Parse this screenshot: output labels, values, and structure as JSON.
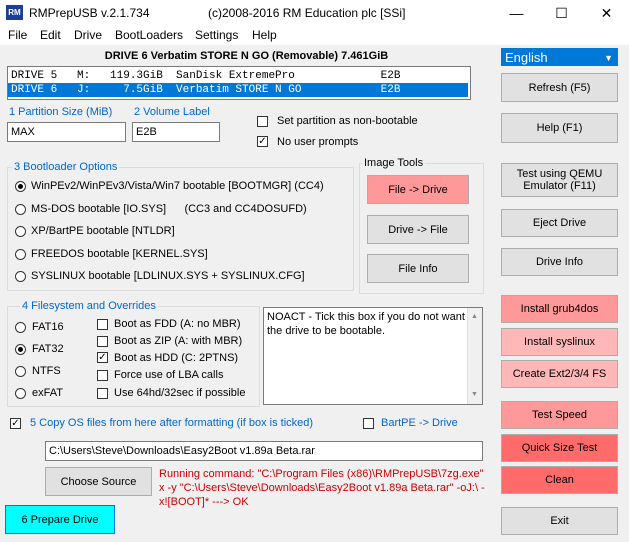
{
  "window": {
    "icon_text": "RM",
    "title": "RMPrepUSB v.2.1.734",
    "copyright": "(c)2008-2016 RM Education plc [SSi]",
    "min_glyph": "—",
    "max_glyph": "☐",
    "close_glyph": "✕"
  },
  "menu": [
    "File",
    "Edit",
    "Drive",
    "BootLoaders",
    "Settings",
    "Help"
  ],
  "drive_title": "DRIVE 6 Verbatim STORE N GO  (Removable) 7.461GiB",
  "language": "English",
  "drives": [
    "DRIVE 5   M:   119.3GiB  SanDisk ExtremePro             E2B",
    "DRIVE 6   J:     7.5GiB  Verbatim STORE N GO            E2B"
  ],
  "partition": {
    "size_label": "1 Partition Size (MiB)",
    "size_value": "MAX",
    "volume_label": "2 Volume Label",
    "volume_value": "E2B",
    "nonbootable_label": "Set partition as non-bootable",
    "noprompts_label": "No user prompts"
  },
  "bootloader": {
    "title": "3 Bootloader Options",
    "options": [
      "WinPEv2/WinPEv3/Vista/Win7 bootable [BOOTMGR] (CC4)",
      "MS-DOS bootable [IO.SYS]      (CC3 and CC4DOSUFD)",
      "XP/BartPE bootable [NTLDR]",
      "FREEDOS bootable [KERNEL.SYS]",
      "SYSLINUX bootable [LDLINUX.SYS + SYSLINUX.CFG]"
    ]
  },
  "image_tools": {
    "title": "Image Tools",
    "file_to_drive": "File -> Drive",
    "drive_to_file": "Drive -> File",
    "file_info": "File Info"
  },
  "filesystem": {
    "title": "4 Filesystem and Overrides",
    "options": [
      "FAT16",
      "FAT32",
      "NTFS",
      "exFAT"
    ],
    "overrides": [
      "Boot as FDD (A: no MBR)",
      "Boot as ZIP (A: with MBR)",
      "Boot as HDD (C: 2PTNS)",
      "Force use of LBA calls",
      "Use 64hd/32sec if possible"
    ]
  },
  "info_text": "NOACT - Tick this box if you do not want the drive to be bootable.",
  "copy": {
    "label": "5 Copy OS files from here after formatting (if box is ticked)",
    "bartpe_label": "BartPE -> Drive",
    "path": "C:\\Users\\Steve\\Downloads\\Easy2Boot v1.89a Beta.rar"
  },
  "choose_source": "Choose Source",
  "running_command": "Running command: \"C:\\Program Files (x86)\\RMPrepUSB\\7zg.exe\" x -y \"C:\\Users\\Steve\\Downloads\\Easy2Boot v1.89a Beta.rar\" -oJ:\\ -x![BOOT]* ---> OK",
  "prepare_drive": "6 Prepare Drive",
  "right_buttons": {
    "refresh": "Refresh (F5)",
    "help": "Help (F1)",
    "qemu": "Test using QEMU Emulator (F11)",
    "eject": "Eject Drive",
    "drive_info": "Drive Info",
    "grub4dos": "Install grub4dos",
    "syslinux": "Install syslinux",
    "ext": "Create Ext2/3/4 FS",
    "test_speed": "Test Speed",
    "quick_size": "Quick Size Test",
    "clean": "Clean",
    "exit": "Exit"
  },
  "colors": {
    "selection": "#0078d7",
    "link_blue": "#0066cc",
    "command_red": "#cc0000",
    "pink": "#ff9999",
    "red": "#ff6b6b",
    "cyan": "#00ffff"
  }
}
